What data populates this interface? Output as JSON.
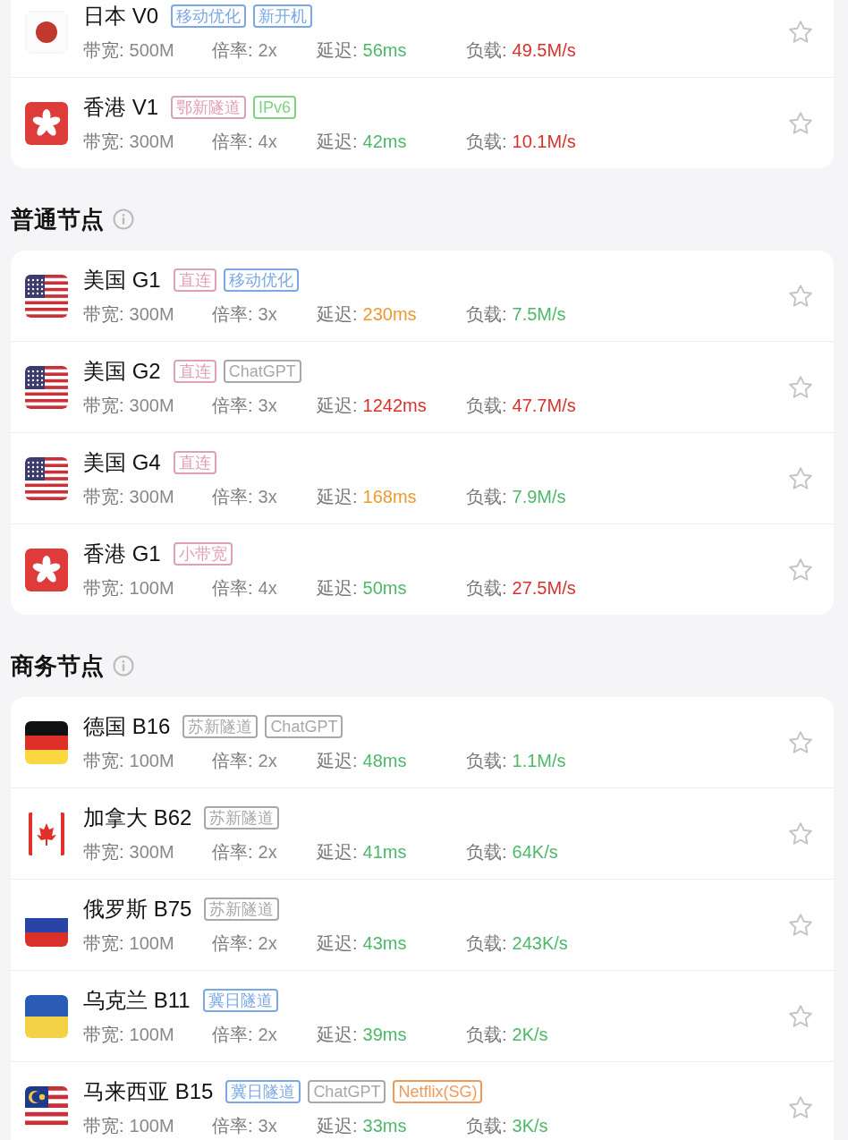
{
  "sections": [
    {
      "nodes": [
        {
          "kind": "jp",
          "name": "日本 V0",
          "starred": false,
          "tags": [
            {
              "text": "移动优化",
              "color": "#7aa8e6"
            },
            {
              "text": "新开机",
              "color": "#7aa8e6"
            }
          ],
          "metrics": [
            {
              "label": "带宽:",
              "value": "500M"
            },
            {
              "label": "倍率:",
              "value": "2x"
            },
            {
              "label": "延迟:",
              "value": "56ms",
              "color": "#4cb86a"
            },
            {
              "label": "负载:",
              "value": "49.5M/s",
              "color": "#d9302c"
            }
          ]
        },
        {
          "kind": "hk",
          "name": "香港 V1",
          "starred": false,
          "tags": [
            {
              "text": "鄂新隧道",
              "color": "#e0a0b4"
            },
            {
              "text": "IPv6",
              "color": "#7fd27f"
            }
          ],
          "metrics": [
            {
              "label": "带宽:",
              "value": "300M"
            },
            {
              "label": "倍率:",
              "value": "4x"
            },
            {
              "label": "延迟:",
              "value": "42ms",
              "color": "#4cb86a"
            },
            {
              "label": "负载:",
              "value": "10.1M/s",
              "color": "#d9302c"
            }
          ]
        }
      ]
    },
    {
      "title": "普通节点",
      "nodes": [
        {
          "kind": "us",
          "name": "美国 G1",
          "starred": false,
          "tags": [
            {
              "text": "直连",
              "color": "#e0a0b4"
            },
            {
              "text": "移动优化",
              "color": "#7aa8e6"
            }
          ],
          "metrics": [
            {
              "label": "带宽:",
              "value": "300M"
            },
            {
              "label": "倍率:",
              "value": "3x"
            },
            {
              "label": "延迟:",
              "value": "230ms",
              "color": "#eb9a2e"
            },
            {
              "label": "负载:",
              "value": "7.5M/s",
              "color": "#4cb86a"
            }
          ]
        },
        {
          "kind": "us",
          "name": "美国 G2",
          "starred": false,
          "tags": [
            {
              "text": "直连",
              "color": "#e0a0b4"
            },
            {
              "text": "ChatGPT",
              "color": "#a8a8a8"
            }
          ],
          "metrics": [
            {
              "label": "带宽:",
              "value": "300M"
            },
            {
              "label": "倍率:",
              "value": "3x"
            },
            {
              "label": "延迟:",
              "value": "1242ms",
              "color": "#d9302c"
            },
            {
              "label": "负载:",
              "value": "47.7M/s",
              "color": "#d9302c"
            }
          ]
        },
        {
          "kind": "us",
          "name": "美国 G4",
          "starred": false,
          "tags": [
            {
              "text": "直连",
              "color": "#e0a0b4"
            }
          ],
          "metrics": [
            {
              "label": "带宽:",
              "value": "300M"
            },
            {
              "label": "倍率:",
              "value": "3x"
            },
            {
              "label": "延迟:",
              "value": "168ms",
              "color": "#eb9a2e"
            },
            {
              "label": "负载:",
              "value": "7.9M/s",
              "color": "#4cb86a"
            }
          ]
        },
        {
          "kind": "hk",
          "name": "香港 G1",
          "starred": false,
          "tags": [
            {
              "text": "小带宽",
              "color": "#e0a0b4"
            }
          ],
          "metrics": [
            {
              "label": "带宽:",
              "value": "100M"
            },
            {
              "label": "倍率:",
              "value": "4x"
            },
            {
              "label": "延迟:",
              "value": "50ms",
              "color": "#4cb86a"
            },
            {
              "label": "负载:",
              "value": "27.5M/s",
              "color": "#d9302c"
            }
          ]
        }
      ]
    },
    {
      "title": "商务节点",
      "nodes": [
        {
          "kind": "de",
          "name": "德国 B16",
          "starred": false,
          "tags": [
            {
              "text": "苏新隧道",
              "color": "#a8a8a8"
            },
            {
              "text": "ChatGPT",
              "color": "#a8a8a8"
            }
          ],
          "metrics": [
            {
              "label": "带宽:",
              "value": "100M"
            },
            {
              "label": "倍率:",
              "value": "2x"
            },
            {
              "label": "延迟:",
              "value": "48ms",
              "color": "#4cb86a"
            },
            {
              "label": "负载:",
              "value": "1.1M/s",
              "color": "#4cb86a"
            }
          ]
        },
        {
          "kind": "ca",
          "name": "加拿大 B62",
          "starred": false,
          "tags": [
            {
              "text": "苏新隧道",
              "color": "#a8a8a8"
            }
          ],
          "metrics": [
            {
              "label": "带宽:",
              "value": "300M"
            },
            {
              "label": "倍率:",
              "value": "2x"
            },
            {
              "label": "延迟:",
              "value": "41ms",
              "color": "#4cb86a"
            },
            {
              "label": "负载:",
              "value": "64K/s",
              "color": "#4cb86a"
            }
          ]
        },
        {
          "kind": "ru",
          "name": "俄罗斯 B75",
          "starred": false,
          "tags": [
            {
              "text": "苏新隧道",
              "color": "#a8a8a8"
            }
          ],
          "metrics": [
            {
              "label": "带宽:",
              "value": "100M"
            },
            {
              "label": "倍率:",
              "value": "2x"
            },
            {
              "label": "延迟:",
              "value": "43ms",
              "color": "#4cb86a"
            },
            {
              "label": "负载:",
              "value": "243K/s",
              "color": "#4cb86a"
            }
          ]
        },
        {
          "kind": "ua",
          "name": "乌克兰 B11",
          "starred": false,
          "tags": [
            {
              "text": "冀日隧道",
              "color": "#7aa8e6"
            }
          ],
          "metrics": [
            {
              "label": "带宽:",
              "value": "100M"
            },
            {
              "label": "倍率:",
              "value": "2x"
            },
            {
              "label": "延迟:",
              "value": "39ms",
              "color": "#4cb86a"
            },
            {
              "label": "负载:",
              "value": "2K/s",
              "color": "#4cb86a"
            }
          ]
        },
        {
          "kind": "my",
          "name": "马来西亚 B15",
          "starred": false,
          "tags": [
            {
              "text": "冀日隧道",
              "color": "#7aa8e6"
            },
            {
              "text": "ChatGPT",
              "color": "#a8a8a8"
            },
            {
              "text": "Netflix(SG)",
              "color": "#ef9a5a"
            }
          ],
          "metrics": [
            {
              "label": "带宽:",
              "value": "100M"
            },
            {
              "label": "倍率:",
              "value": "3x"
            },
            {
              "label": "延迟:",
              "value": "33ms",
              "color": "#4cb86a"
            },
            {
              "label": "负载:",
              "value": "3K/s",
              "color": "#4cb86a"
            }
          ]
        }
      ]
    }
  ]
}
